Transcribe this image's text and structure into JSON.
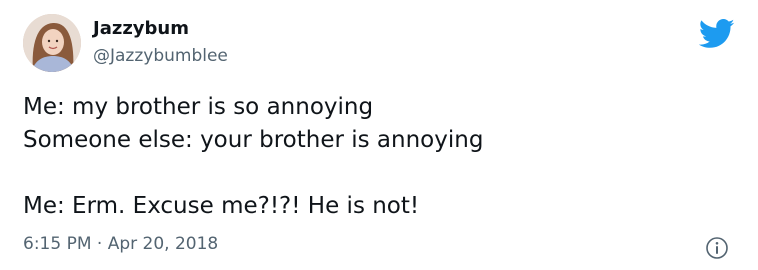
{
  "author": {
    "display_name": "Jazzybum",
    "handle": "@Jazzybumblee"
  },
  "tweet": {
    "lines": [
      "Me: my brother is so annoying",
      "Someone else: your brother is annoying",
      "",
      "Me: Erm. Excuse me?!?! He is not!"
    ],
    "timestamp": "6:15 PM · Apr 20, 2018"
  },
  "icons": {
    "logo": "twitter-bird-icon",
    "info": "info-icon"
  },
  "colors": {
    "brand": "#1d9bf0",
    "secondary_text": "#536471",
    "primary_text": "#0f1419"
  }
}
